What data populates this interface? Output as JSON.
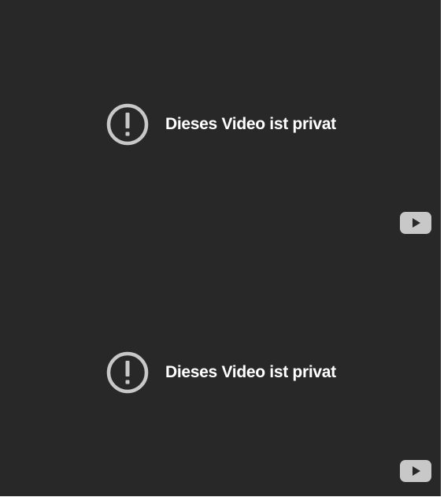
{
  "embeds": [
    {
      "error_icon": "exclamation-circle-icon",
      "error_message": "Dieses Video ist privat",
      "logo_icon": "youtube-logo-icon"
    },
    {
      "error_icon": "exclamation-circle-icon",
      "error_message": "Dieses Video ist privat",
      "logo_icon": "youtube-logo-icon"
    }
  ],
  "colors": {
    "player_background": "#282828",
    "icon_gray": "#c8c8c8",
    "text": "#ffffff",
    "logo_gray": "#c8c8c8"
  }
}
